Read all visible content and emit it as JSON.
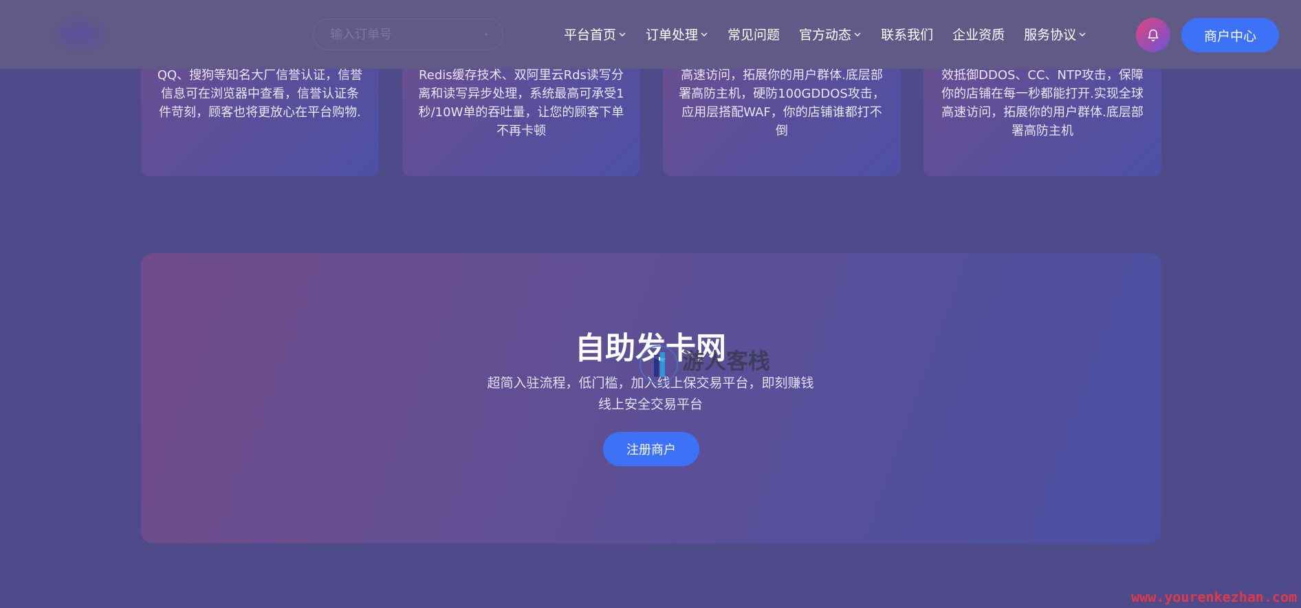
{
  "header": {
    "search": {
      "placeholder": "输入订单号",
      "value": ""
    },
    "nav": [
      {
        "label": "平台首页",
        "dropdown": true
      },
      {
        "label": "订单处理",
        "dropdown": true
      },
      {
        "label": "常见问题",
        "dropdown": false
      },
      {
        "label": "官方动态",
        "dropdown": true
      },
      {
        "label": "联系我们",
        "dropdown": false
      },
      {
        "label": "企业资质",
        "dropdown": false
      },
      {
        "label": "服务协议",
        "dropdown": true
      }
    ],
    "merchant_label": "商户中心"
  },
  "cards": [
    {
      "text": "QQ、搜狗等知名大厂信誉认证，信誉信息可在浏览器中查看，信誉认证条件苛刻，顾客也将更放心在平台购物."
    },
    {
      "text": "Redis缓存技术、双阿里云Rds读写分离和读写异步处理，系统最高可承受1秒/10W单的吞吐量，让您的顾客下单不再卡顿"
    },
    {
      "text": "高速访问，拓展你的用户群体.底层部署高防主机，硬防100GDDOS攻击，应用层搭配WAF，你的店铺谁都打不倒"
    },
    {
      "text": "效抵御DDOS、CC、NTP攻击，保障你的店铺在每一秒都能打开.实现全球高速访问，拓展你的用户群体.底层部署高防主机"
    }
  ],
  "cta": {
    "title": "自助发卡网",
    "line1": "超简入驻流程，低门槛，加入线上保交易平台，即刻赚钱",
    "line2": "线上安全交易平台",
    "button": "注册商户"
  },
  "watermark": {
    "text": "游人客栈",
    "url": "www.yourenkezhan.com"
  },
  "colors": {
    "background": "#4f4a8a",
    "header": "#5f5a86",
    "accent": "#3d72f6",
    "bell_gradient": [
      "#e0457b",
      "#6a54d8"
    ]
  }
}
